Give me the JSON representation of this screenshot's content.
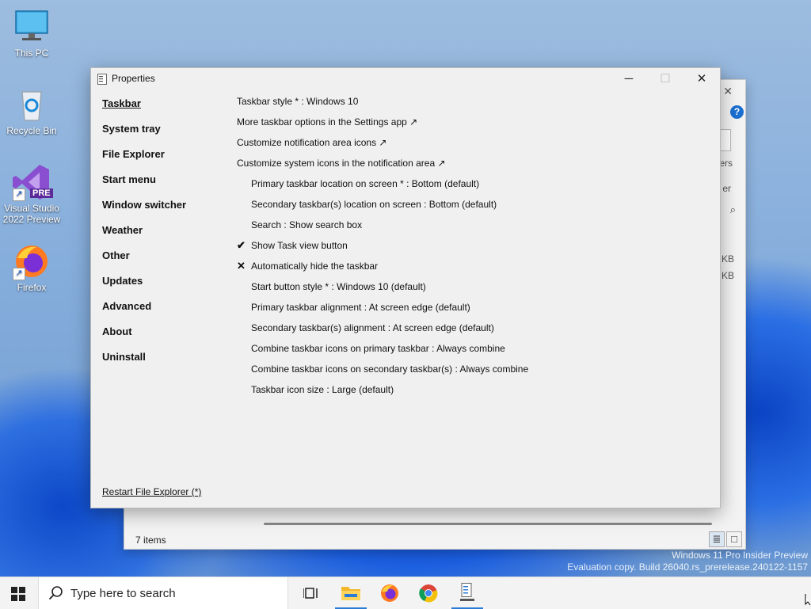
{
  "desktop": {
    "icons": [
      {
        "label": "This PC",
        "icon": "monitor-icon"
      },
      {
        "label": "Recycle Bin",
        "icon": "recycle-bin-icon"
      },
      {
        "label": "Visual Studio 2022 Preview",
        "icon": "visual-studio-icon",
        "badge": "PRE"
      },
      {
        "label": "Firefox",
        "icon": "firefox-icon"
      }
    ]
  },
  "background_window": {
    "status": "7 items",
    "partial_texts": [
      "ers",
      "er",
      "KB",
      "KB"
    ]
  },
  "window": {
    "title": "Properties",
    "minimize": "─",
    "maximize": "☐",
    "close": "✕",
    "sidebar": [
      {
        "label": "Taskbar",
        "active": true
      },
      {
        "label": "System tray"
      },
      {
        "label": "File Explorer"
      },
      {
        "label": "Start menu"
      },
      {
        "label": "Window switcher"
      },
      {
        "label": "Weather"
      },
      {
        "label": "Other"
      },
      {
        "label": "Updates"
      },
      {
        "label": "Advanced"
      },
      {
        "label": "About"
      },
      {
        "label": "Uninstall"
      }
    ],
    "options": [
      {
        "label": "Taskbar style * : Windows 10"
      },
      {
        "label": "More taskbar options in the Settings app ↗"
      },
      {
        "label": "Customize notification area icons ↗"
      },
      {
        "label": "Customize system icons in the notification area ↗"
      },
      {
        "label": "Primary taskbar location on screen * : Bottom (default)"
      },
      {
        "label": "Secondary taskbar(s) location on screen : Bottom (default)"
      },
      {
        "label": "Search : Show search box"
      },
      {
        "label": "Show Task view button",
        "mark": "✔"
      },
      {
        "label": "Automatically hide the taskbar",
        "mark": "✕"
      },
      {
        "label": "Start button style * : Windows 10 (default)"
      },
      {
        "label": "Primary taskbar alignment : At screen edge (default)"
      },
      {
        "label": "Secondary taskbar(s) alignment : At screen edge (default)"
      },
      {
        "label": "Combine taskbar icons on primary taskbar : Always combine"
      },
      {
        "label": "Combine taskbar icons on secondary taskbar(s) : Always combine"
      },
      {
        "label": "Taskbar icon size : Large (default)"
      }
    ],
    "restart": "Restart File Explorer (*)"
  },
  "watermark": {
    "line1": "Windows 11 Pro Insider Preview",
    "line2": "Evaluation copy. Build 26040.rs_prerelease.240122-1157"
  },
  "taskbar": {
    "search_placeholder": "Type here to search",
    "apps": [
      "task-view-icon",
      "file-explorer-icon",
      "firefox-icon",
      "chrome-icon",
      "properties-app-icon"
    ]
  },
  "colors": {
    "accent": "#2a7ad6",
    "window_bg": "#f0f0f0",
    "taskbar_bg": "#f3f3f3"
  }
}
